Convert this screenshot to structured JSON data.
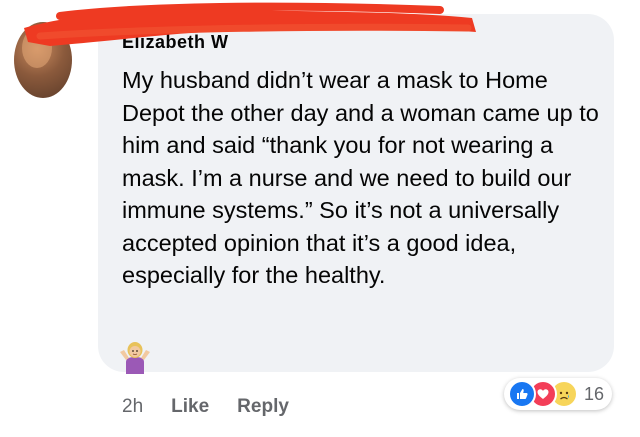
{
  "comment": {
    "author_name": "Elizabeth W",
    "text": "My husband didn’t wear a mask to Home Depot the other day and a woman came up to him and said “thank you for not wearing a mask. I’m a nurse and we need to build our immune systems.” So it’s not a universally accepted opinion that it’s a good idea, especially for the healthy.",
    "inline_emoji": "person-shrugging-icon"
  },
  "actions": {
    "timestamp": "2h",
    "like_label": "Like",
    "reply_label": "Reply"
  },
  "reactions": {
    "icons": [
      "like-reaction-icon",
      "love-reaction-icon",
      "sad-reaction-icon"
    ],
    "count": "16"
  },
  "colors": {
    "bubble_background": "#f0f2f5",
    "text": "#050505",
    "secondary_text": "#65676b",
    "like_blue": "#1877f2",
    "love_red": "#f33e58",
    "sad_yellow": "#f7d55a",
    "redaction_red": "#ee3a22"
  }
}
